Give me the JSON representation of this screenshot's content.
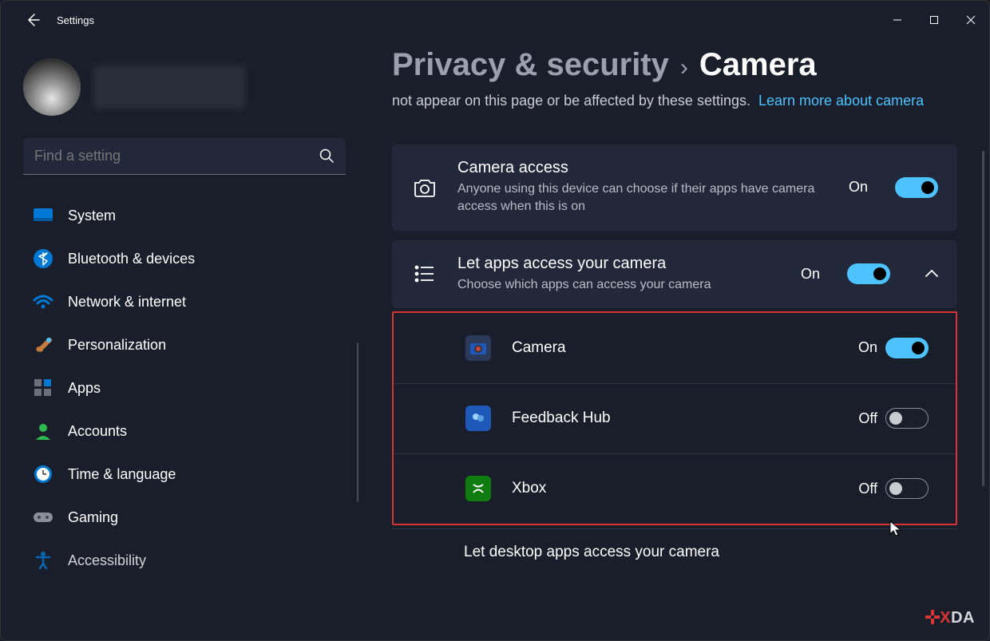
{
  "titlebar": {
    "title": "Settings"
  },
  "search": {
    "placeholder": "Find a setting"
  },
  "nav": {
    "items": [
      {
        "label": "System",
        "icon": "system"
      },
      {
        "label": "Bluetooth & devices",
        "icon": "bluetooth"
      },
      {
        "label": "Network & internet",
        "icon": "wifi"
      },
      {
        "label": "Personalization",
        "icon": "brush"
      },
      {
        "label": "Apps",
        "icon": "apps"
      },
      {
        "label": "Accounts",
        "icon": "account"
      },
      {
        "label": "Time & language",
        "icon": "clock"
      },
      {
        "label": "Gaming",
        "icon": "gamepad"
      },
      {
        "label": "Accessibility",
        "icon": "accessibility"
      }
    ]
  },
  "header": {
    "crumb_parent": "Privacy & security",
    "crumb_current": "Camera",
    "description_fragment": "not appear on this page or be affected by these settings.",
    "learn_more": "Learn more about camera"
  },
  "cards": {
    "camera_access": {
      "title": "Camera access",
      "subtitle": "Anyone using this device can choose if their apps have camera access when this is on",
      "state_label": "On",
      "on": true
    },
    "let_apps": {
      "title": "Let apps access your camera",
      "subtitle": "Choose which apps can access your camera",
      "state_label": "On",
      "on": true
    }
  },
  "apps": [
    {
      "name": "Camera",
      "state_label": "On",
      "on": true,
      "icon_color": "#1e58b8"
    },
    {
      "name": "Feedback Hub",
      "state_label": "Off",
      "on": false,
      "icon_color": "#1e58b8"
    },
    {
      "name": "Xbox",
      "state_label": "Off",
      "on": false,
      "icon_color": "#107c10"
    }
  ],
  "partial_next": "Let desktop apps access your camera",
  "watermark": {
    "brand_x": "X",
    "brand_rest": "DA"
  }
}
